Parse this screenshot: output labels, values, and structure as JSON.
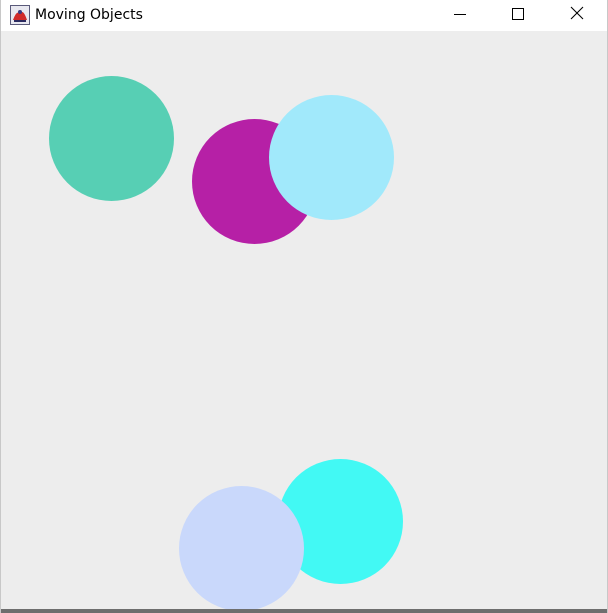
{
  "window": {
    "title": "Moving Objects",
    "controls": {
      "minimize_icon": "minimize-icon",
      "maximize_icon": "maximize-icon",
      "close_icon": "close-icon"
    }
  },
  "canvas": {
    "background": "#ededed",
    "objects": [
      {
        "name": "teal-circle",
        "color": "#57cfb4"
      },
      {
        "name": "magenta-circle",
        "color": "#b620a6"
      },
      {
        "name": "light-blue-circle",
        "color": "#a1e9fb"
      },
      {
        "name": "cyan-circle",
        "color": "#42f9f4"
      },
      {
        "name": "lavender-circle",
        "color": "#c9d8fb"
      }
    ]
  }
}
